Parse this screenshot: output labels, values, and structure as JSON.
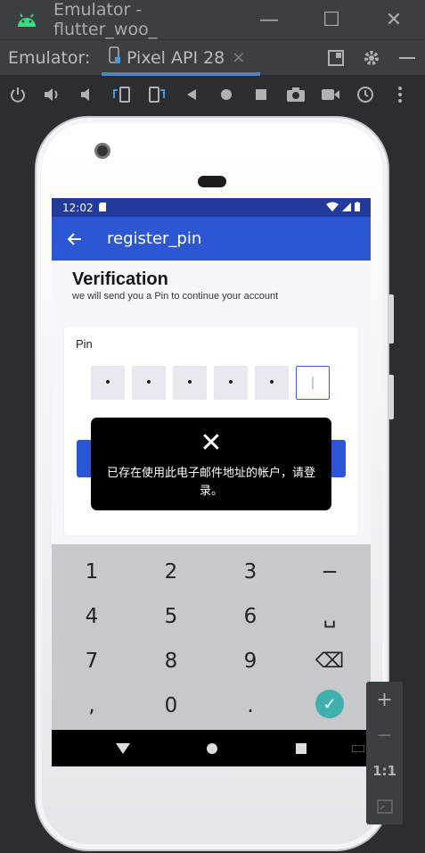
{
  "window": {
    "title": "Emulator - flutter_woo_",
    "minimize": "—",
    "maximize": "☐",
    "close": "✕"
  },
  "tabbar": {
    "label": "Emulator:",
    "tab_label": "Pixel API 28",
    "tab_close": "×"
  },
  "device": {
    "status_time": "12:02",
    "app_title": "register_pin",
    "heading": "Verification",
    "subheading": "we will send you a Pin to continue your account",
    "pin_label": "Pin",
    "pins": [
      "•",
      "•",
      "•",
      "•",
      "•",
      "|"
    ],
    "toast": {
      "close": "✕",
      "message": "已存在使用此电子邮件地址的帐户，请登录。"
    },
    "keys": [
      "1",
      "2",
      "3",
      "−",
      "4",
      "5",
      "6",
      "␣",
      "7",
      "8",
      "9",
      "⌫",
      ",",
      "0",
      "."
    ],
    "done_key": "✓"
  },
  "zoom_controls": {
    "plus": "+",
    "minus": "−",
    "one_to_one": "1:1"
  },
  "colors": {
    "accent": "#2d56d4",
    "statusbar": "#233a9a",
    "done": "#3fb0ad"
  }
}
